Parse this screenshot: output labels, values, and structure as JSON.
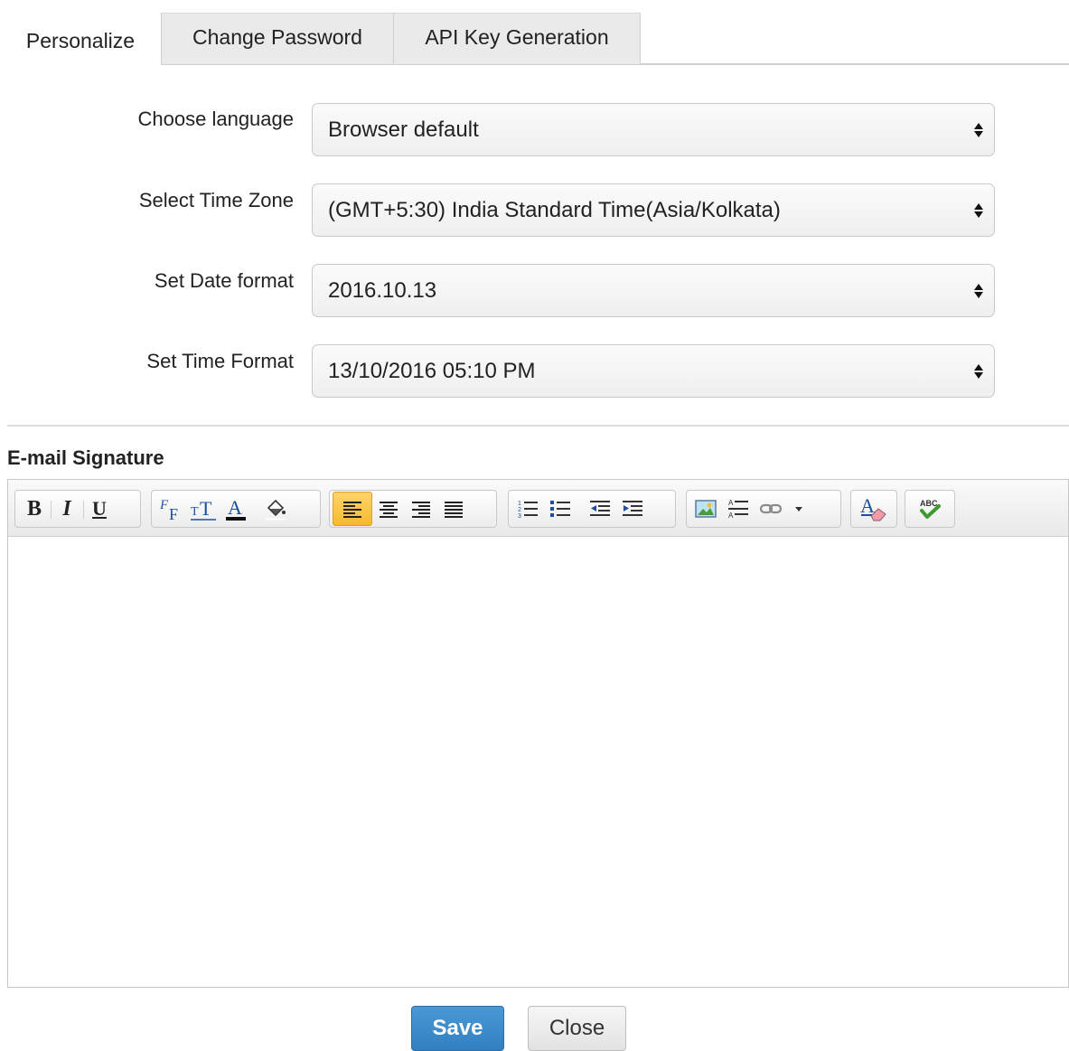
{
  "tabs": [
    {
      "label": "Personalize",
      "active": true
    },
    {
      "label": "Change Password",
      "active": false
    },
    {
      "label": "API Key Generation",
      "active": false
    }
  ],
  "form": {
    "language": {
      "label": "Choose language",
      "value": "Browser default"
    },
    "timezone": {
      "label": "Select Time Zone",
      "value": "(GMT+5:30) India Standard Time(Asia/Kolkata)"
    },
    "date_format": {
      "label": "Set Date format",
      "value": "2016.10.13"
    },
    "time_format": {
      "label": "Set Time Format",
      "value": "13/10/2016 05:10 PM"
    }
  },
  "signature": {
    "title": "E-mail Signature",
    "toolbar": {
      "bold": "B",
      "italic": "I",
      "underline": "U",
      "icons": [
        "font-family-icon",
        "font-size-icon",
        "font-color-icon",
        "background-color-icon",
        "align-left-icon",
        "align-center-icon",
        "align-right-icon",
        "align-justify-icon",
        "ordered-list-icon",
        "unordered-list-icon",
        "outdent-icon",
        "indent-icon",
        "insert-image-icon",
        "horizontal-rule-icon",
        "link-icon",
        "dropdown-icon",
        "remove-format-icon",
        "spellcheck-icon"
      ],
      "active": "align-left"
    }
  },
  "actions": {
    "save": "Save",
    "close": "Close"
  },
  "colors": {
    "primary": "#3a8bcc",
    "active_tool": "#f6b92c"
  }
}
